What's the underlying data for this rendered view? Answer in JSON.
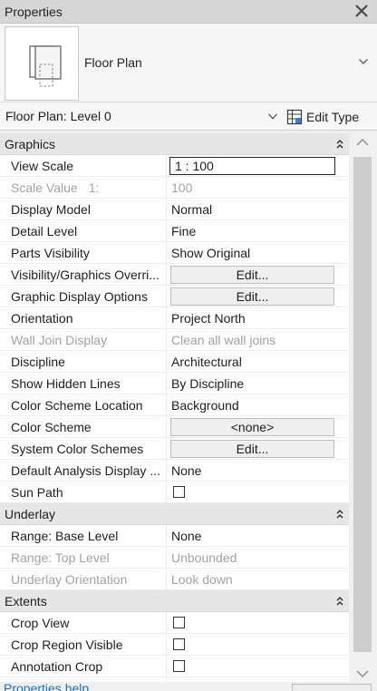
{
  "panel": {
    "title": "Properties"
  },
  "type_selector": {
    "type_name": "Floor Plan"
  },
  "instance_bar": {
    "instance": "Floor Plan: Level 0",
    "edit_type_label": "Edit Type"
  },
  "groups": {
    "graphics": {
      "label": "Graphics",
      "rows": {
        "view_scale": {
          "label": "View Scale",
          "value": "1 : 100"
        },
        "scale_value": {
          "label": "Scale Value",
          "label_suffix": "1:",
          "value": "100"
        },
        "display_model": {
          "label": "Display Model",
          "value": "Normal"
        },
        "detail_level": {
          "label": "Detail Level",
          "value": "Fine"
        },
        "parts_visibility": {
          "label": "Parts Visibility",
          "value": "Show Original"
        },
        "vg_overrides": {
          "label": "Visibility/Graphics Overri...",
          "value": "Edit..."
        },
        "graphic_display": {
          "label": "Graphic Display Options",
          "value": "Edit..."
        },
        "orientation": {
          "label": "Orientation",
          "value": "Project North"
        },
        "wall_join": {
          "label": "Wall Join Display",
          "value": "Clean all wall joins"
        },
        "discipline": {
          "label": "Discipline",
          "value": "Architectural"
        },
        "hidden_lines": {
          "label": "Show Hidden Lines",
          "value": "By Discipline"
        },
        "color_scheme_location": {
          "label": "Color Scheme Location",
          "value": "Background"
        },
        "color_scheme": {
          "label": "Color Scheme",
          "value": "<none>"
        },
        "system_color_schemes": {
          "label": "System Color Schemes",
          "value": "Edit..."
        },
        "default_analysis": {
          "label": "Default Analysis Display ...",
          "value": "None"
        },
        "sun_path": {
          "label": "Sun Path",
          "checked": false
        }
      }
    },
    "underlay": {
      "label": "Underlay",
      "rows": {
        "base_level": {
          "label": "Range: Base Level",
          "value": "None"
        },
        "top_level": {
          "label": "Range: Top Level",
          "value": "Unbounded"
        },
        "orientation": {
          "label": "Underlay Orientation",
          "value": "Look down"
        }
      }
    },
    "extents": {
      "label": "Extents",
      "rows": {
        "crop_view": {
          "label": "Crop View",
          "checked": false
        },
        "crop_region_visible": {
          "label": "Crop Region Visible",
          "checked": false
        },
        "annotation_crop": {
          "label": "Annotation Crop",
          "checked": false
        }
      }
    }
  },
  "footer": {
    "help_link": "Properties help"
  },
  "icons": {
    "close": "close-icon",
    "type_thumbnail": "floor-plan-type-icon",
    "dropdown": "chevron-down-icon",
    "edit_type": "edit-type-icon",
    "collapse": "collapse-group-icon",
    "scroll_up": "scroll-up-icon",
    "scroll_down": "scroll-down-icon"
  },
  "colors": {
    "link": "#1a6fc0",
    "disabled_text": "#a2a2a2",
    "group_header": "#e6e6e6"
  }
}
